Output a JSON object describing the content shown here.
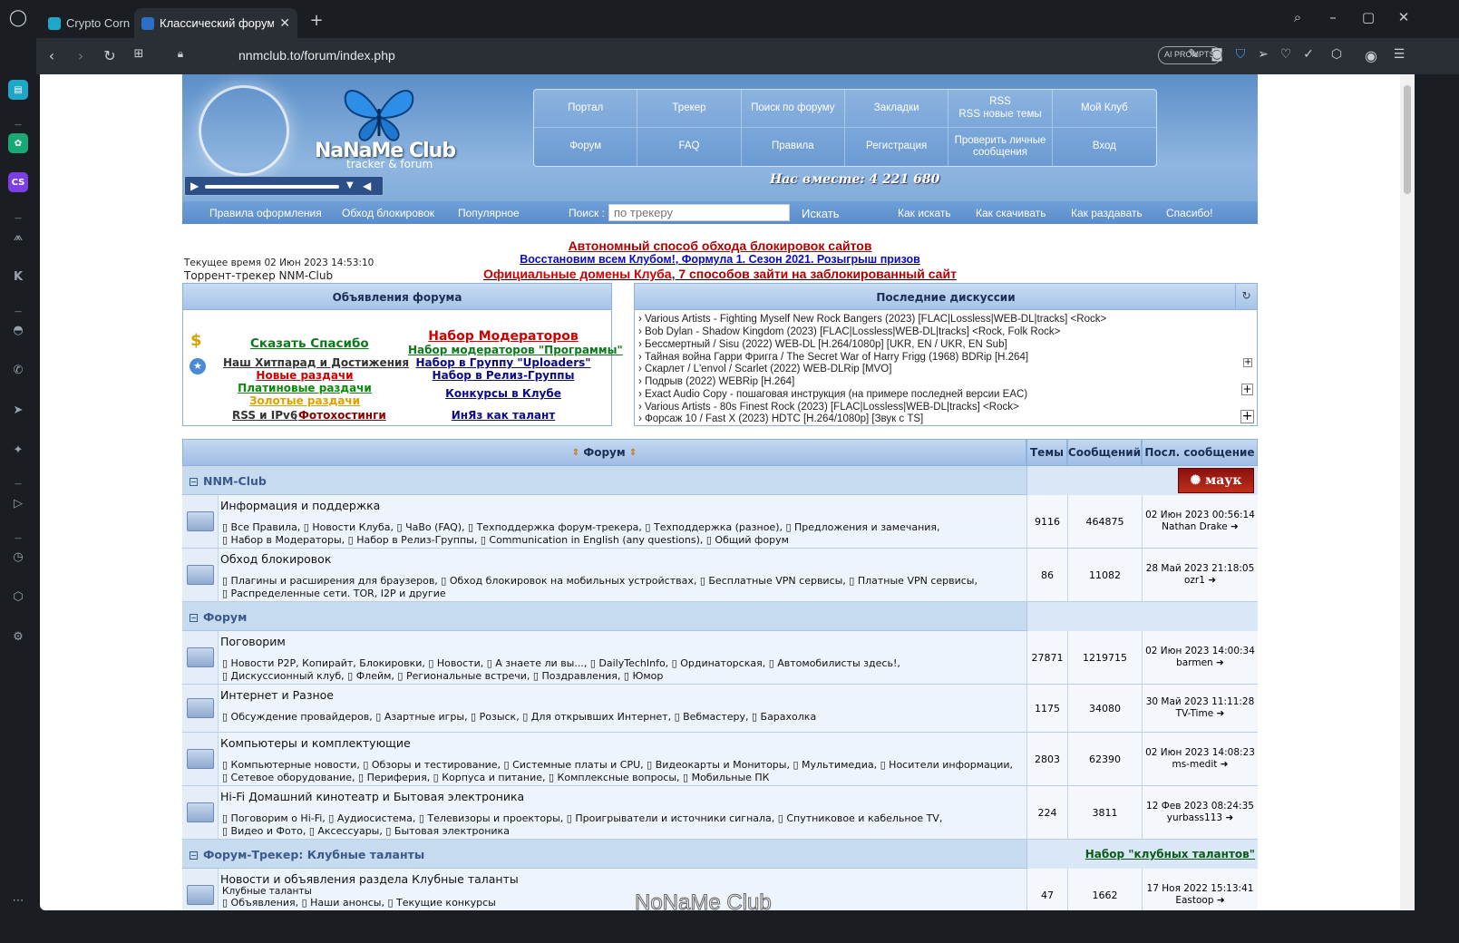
{
  "browser": {
    "tabs": [
      {
        "title": "Crypto Corne",
        "active": false
      },
      {
        "title": "Классический форум-тр",
        "active": true
      }
    ],
    "url": "nnmclub.to/forum/index.php",
    "ai_prompts": "AI PROMPTS"
  },
  "header": {
    "logo_main": "NaNaMe Club",
    "logo_sub": "tracker & forum",
    "menu": [
      "Портал",
      "Трекер",
      "Поиск по форуму",
      "Закладки",
      "RSS\nRSS новые темы",
      "Мой Клуб",
      "Форум",
      "FAQ",
      "Правила",
      "Регистрация",
      "Проверить личные\nсообщения",
      "Вход"
    ],
    "together": "Нас вместе: 4 221 680"
  },
  "subnav": {
    "links": [
      "Правила оформления",
      "Обход блокировок",
      "Популярное"
    ],
    "search_label": "Поиск :",
    "search_placeholder": "по трекеру",
    "search_button": "Искать",
    "right_links": [
      "Как искать",
      "Как скачивать",
      "Как раздавать",
      "Спасибо!"
    ]
  },
  "info": {
    "time": "Текущее время 02 Июн 2023 14:53:10",
    "title": "Торрент-трекер NNM-Club"
  },
  "announcements": {
    "line1": "Автономный способ обхода блокировок сайтов",
    "line2a": "Восстановим всем Клубом!",
    "line2b": "Формула 1. Сезон 2021. Розыгрыш призов",
    "line3a": "Официальные домены Клуба",
    "line3b": "7 способов зайти на заблокированный сайт"
  },
  "forum_ads": {
    "title": "Объявления форума",
    "left": [
      "Сказать Спасибо",
      "Наш Хитпарад и Достижения",
      "Новые раздачи",
      "Платиновые раздачи",
      "Золотые раздачи",
      "RSS и IPv6",
      "Фотохостинги"
    ],
    "right": [
      "Набор Модераторов",
      "Набор модераторов \"Программы\"",
      "Набор в Группу \"Uploaders\"",
      "Набор в Релиз-Группы",
      "Конкурсы в Клубе",
      "ИнЯз как талант"
    ]
  },
  "discussions": {
    "title": "Последние дискуссии",
    "items": [
      "› Various Artists - Fighting Myself New Rock Bangers (2023) [FLAC|Lossless|WEB-DL|tracks] <Rock>",
      "› Bob Dylan - Shadow Kingdom (2023) [FLAC|Lossless|WEB-DL|tracks] <Rock, Folk Rock>",
      "› Бессмертный / Sisu (2022) WEB-DL [H.264/1080p] [UKR, EN / UKR, EN Sub]",
      "› Тайная война Гарри Фригга / The Secret War of Harry Frigg (1968) BDRip [H.264]",
      "› Скарлет / L'envol / Scarlet (2022) WEB-DLRip [MVO]",
      "› Подрыв (2022) WEBRip [H.264]",
      "› Exact Audio Copy - пошаговая инструкция (на примере последней версии EAC)",
      "› Various Artists - 80s Finest Rock (2023) [FLAC|Lossless|WEB-DL|tracks] <Rock>",
      "› Форсаж 10 / Fast X (2023) HDTC [H.264/1080p] [Звук с TS]"
    ]
  },
  "table": {
    "headers": {
      "forum": "Форум",
      "topics": "Темы",
      "posts": "Сообщений",
      "last": "Посл. сообщение"
    },
    "categories": [
      {
        "title": "NNM-Club",
        "extra": "mayak"
      },
      {
        "title": "Форум",
        "extra": ""
      },
      {
        "title": "Форум-Трекер: Клубные таланты",
        "extra": "Набор \"клубных талантов\""
      }
    ],
    "rows": [
      {
        "name": "Информация и поддержка",
        "sub1": "▯ Все Правила, ▯ Новости Клуба, ▯ ЧаВо (FAQ), ▯ Техподдержка форум-трекера, ▯ Техподдержка (разное), ▯ Предложения и замечания,",
        "sub2": "▯ Набор в Модераторы, ▯ Набор в Релиз-Группы, ▯ Communication in English (any questions), ▯ Общий форум",
        "topics": "9116",
        "posts": "464875",
        "last_date": "02 Июн 2023 00:56:14",
        "last_user": "Nathan Drake"
      },
      {
        "name": "Обход блокировок",
        "sub1": "▯ Плагины и расширения для браузеров, ▯ Обход блокировок на мобильных устройствах, ▯ Бесплатные VPN сервисы, ▯ Платные VPN сервисы,",
        "sub2": "▯ Распределенные сети. TOR, I2P и другие",
        "topics": "86",
        "posts": "11082",
        "last_date": "28 Май 2023 21:18:05",
        "last_user": "ozr1"
      },
      {
        "name": "Поговорим",
        "sub1": "▯ Новости P2P, Копирайт, Блокировки, ▯ Новости, ▯ А знаете ли вы..., ▯ DailyTechInfo, ▯ Ординаторская, ▯ Автомобилисты здесь!,",
        "sub2": "▯ Дискуссионный клуб, ▯ Флейм, ▯ Региональные встречи, ▯ Поздравления, ▯ Юмор",
        "topics": "27871",
        "posts": "1219715",
        "last_date": "02 Июн 2023 14:00:34",
        "last_user": "barmen"
      },
      {
        "name": "Интернет и Разное",
        "sub1": "▯ Обсуждение провайдеров, ▯ Азартные игры, ▯ Розыск, ▯ Для открывших Интернет, ▯ Вебмастеру, ▯ Барахолка",
        "sub2": "",
        "topics": "1175",
        "posts": "34080",
        "last_date": "30 Май 2023 11:11:28",
        "last_user": "TV-Time"
      },
      {
        "name": "Компьютеры и комплектующие",
        "sub1": "▯ Компьютерные новости, ▯ Обзоры и тестирование, ▯ Системные платы и CPU, ▯ Видеокарты и Мониторы, ▯ Мультимедиа, ▯ Носители информации,",
        "sub2": "▯ Сетевое оборудование, ▯ Периферия, ▯ Корпуса и питание, ▯ Комплексные вопросы, ▯ Мобильные ПК",
        "topics": "2803",
        "posts": "62390",
        "last_date": "02 Июн 2023 14:08:23",
        "last_user": "ms-medit"
      },
      {
        "name": "Hi-Fi Домашний кинотеатр и Бытовая электроника",
        "sub1": "▯ Поговорим о Hi-Fi, ▯ Аудиосистема, ▯ Телевизоры и проекторы, ▯ Проигрыватели и источники сигнала, ▯ Спутниковое и кабельное TV,",
        "sub2": "▯ Видео и Фото, ▯ Аксессуары, ▯ Бытовая электроника",
        "topics": "224",
        "posts": "3811",
        "last_date": "12 Фев 2023 08:24:35",
        "last_user": "yurbass113"
      },
      {
        "name": "Новости и объявления раздела Клубные таланты",
        "sub0": "Клубные таланты",
        "sub1": "▯ Объявления, ▯ Наши анонсы, ▯ Текущие конкурсы",
        "sub2": "",
        "topics": "47",
        "posts": "1662",
        "last_date": "17 Ноя 2022 15:13:41",
        "last_user": "Eastoop"
      }
    ]
  },
  "watermark": "NoNaMe Club"
}
